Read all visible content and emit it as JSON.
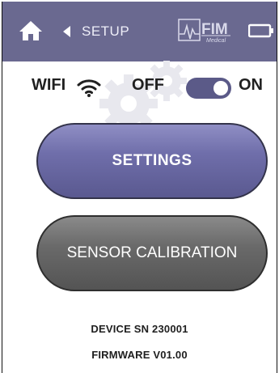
{
  "header": {
    "home_icon": "home-icon",
    "back_icon": "chevron-left-icon",
    "title": "SETUP",
    "logo_text": "FIM",
    "logo_subtext": "Medical",
    "battery_icon": "battery-icon",
    "colors": {
      "background": "#6a6990",
      "text": "#eeeef8"
    }
  },
  "wifi": {
    "label": "WIFI",
    "icon": "wifi-icon",
    "off_label": "OFF",
    "on_label": "ON",
    "state": "on",
    "toggle_color": "#5b5a88"
  },
  "watermark_icon": "gears-icon",
  "buttons": {
    "settings_label": "SETTINGS",
    "calibration_label": "SENSOR CALIBRATION",
    "settings_color": "#6f6eaa",
    "calibration_color": "#6a6a6a"
  },
  "device": {
    "serial": "DEVICE SN 230001",
    "firmware": "FIRMWARE V01.00"
  }
}
